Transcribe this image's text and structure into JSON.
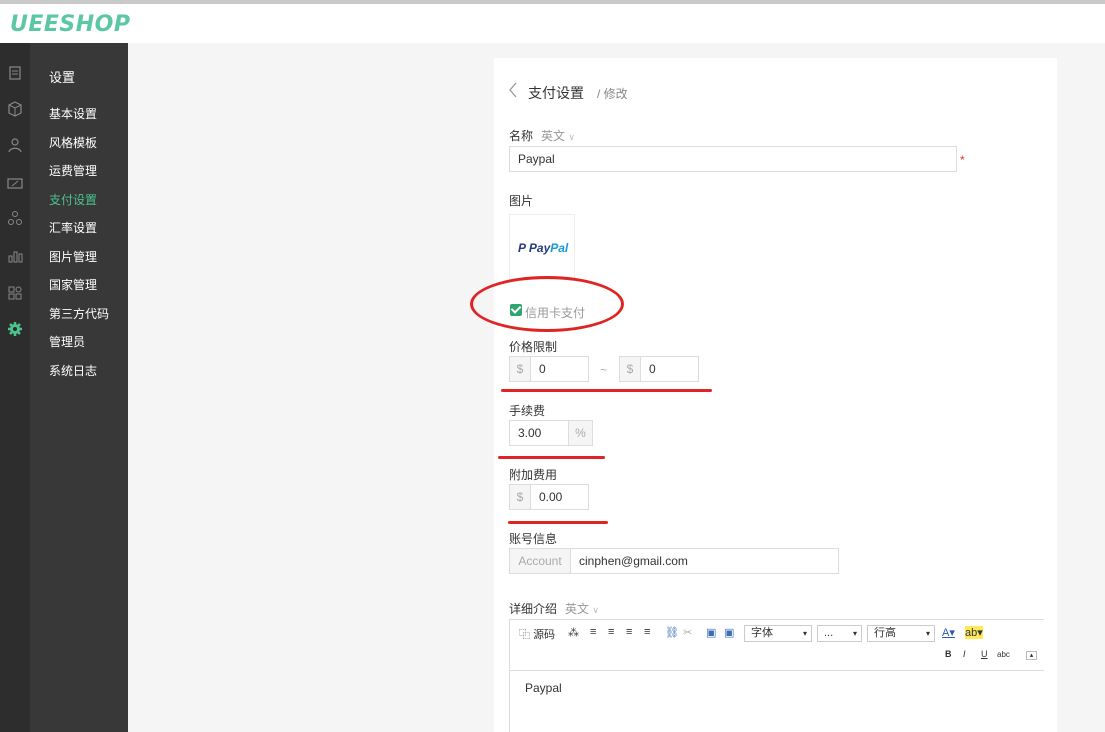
{
  "brand": {
    "logo": "UEESHOP"
  },
  "sidebar": {
    "title": "设置",
    "items": [
      {
        "label": "基本设置"
      },
      {
        "label": "风格模板"
      },
      {
        "label": "运费管理"
      },
      {
        "label": "支付设置"
      },
      {
        "label": "汇率设置"
      },
      {
        "label": "图片管理"
      },
      {
        "label": "国家管理"
      },
      {
        "label": "第三方代码"
      },
      {
        "label": "管理员"
      },
      {
        "label": "系统日志"
      }
    ],
    "active": "支付设置",
    "accent_color": "#4cc38f"
  },
  "header": {
    "title": "支付设置",
    "subtitle": "/ 修改"
  },
  "form": {
    "name": {
      "label": "名称",
      "lang": "英文",
      "value": "Paypal",
      "required_mark": "*"
    },
    "image": {
      "label": "图片",
      "logo_text_a": "P Pay",
      "logo_text_b": "Pal"
    },
    "credit_card": {
      "label": "信用卡支付",
      "checked": true
    },
    "price_limit": {
      "label": "价格限制",
      "currency": "$",
      "min": "0",
      "separator": "~",
      "max": "0"
    },
    "fee": {
      "label": "手续费",
      "value": "3.00",
      "unit": "%"
    },
    "extra_fee": {
      "label": "附加费用",
      "currency": "$",
      "value": "0.00"
    },
    "account": {
      "label": "账号信息",
      "prefix": "Account",
      "value": "cinphen@gmail.com"
    },
    "description": {
      "label": "详细介绍",
      "lang": "英文",
      "content": "Paypal"
    }
  },
  "editor_toolbar": {
    "source": "源码",
    "font": "字体",
    "size": "...",
    "line_height": "行高",
    "bold": "B",
    "italic": "I",
    "underline": "U",
    "strike": "abc"
  }
}
